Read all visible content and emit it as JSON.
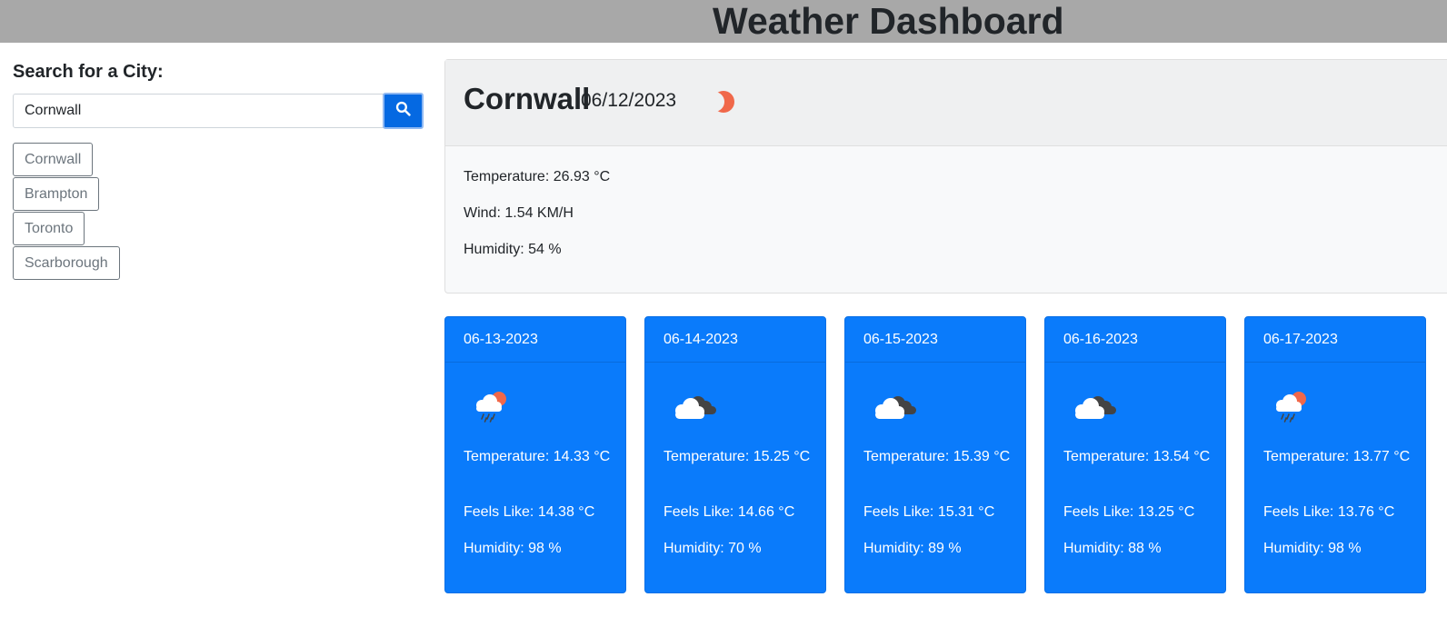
{
  "header": {
    "title": "Weather Dashboard"
  },
  "search": {
    "label": "Search for a City:",
    "value": "Cornwall",
    "button_icon": "search-icon"
  },
  "history": [
    "Cornwall",
    "Brampton",
    "Toronto",
    "Scarborough"
  ],
  "current": {
    "city": "Cornwall",
    "date": "06/12/2023",
    "icon": "moon-partial-icon",
    "temperature": "Temperature: 26.93 °C",
    "wind": "Wind: 1.54 KM/H",
    "humidity": "Humidity: 54 %"
  },
  "forecast": [
    {
      "date": "06-13-2023",
      "icon": "rain-sun-icon",
      "temperature": "Temperature: 14.33 °C",
      "feels_like": "Feels Like: 14.38 °C",
      "humidity": "Humidity: 98 %"
    },
    {
      "date": "06-14-2023",
      "icon": "broken-clouds-icon",
      "temperature": "Temperature: 15.25 °C",
      "feels_like": "Feels Like: 14.66 °C",
      "humidity": "Humidity: 70 %"
    },
    {
      "date": "06-15-2023",
      "icon": "broken-clouds-icon",
      "temperature": "Temperature: 15.39 °C",
      "feels_like": "Feels Like: 15.31 °C",
      "humidity": "Humidity: 89 %"
    },
    {
      "date": "06-16-2023",
      "icon": "broken-clouds-icon",
      "temperature": "Temperature: 13.54 °C",
      "feels_like": "Feels Like: 13.25 °C",
      "humidity": "Humidity: 88 %"
    },
    {
      "date": "06-17-2023",
      "icon": "rain-sun-icon",
      "temperature": "Temperature: 13.77 °C",
      "feels_like": "Feels Like: 13.76 °C",
      "humidity": "Humidity: 98 %"
    }
  ],
  "colors": {
    "header_bg": "#a8a8a8",
    "primary": "#0a7bfb",
    "button_bg": "#0569e2",
    "sun": "#f0684a"
  }
}
